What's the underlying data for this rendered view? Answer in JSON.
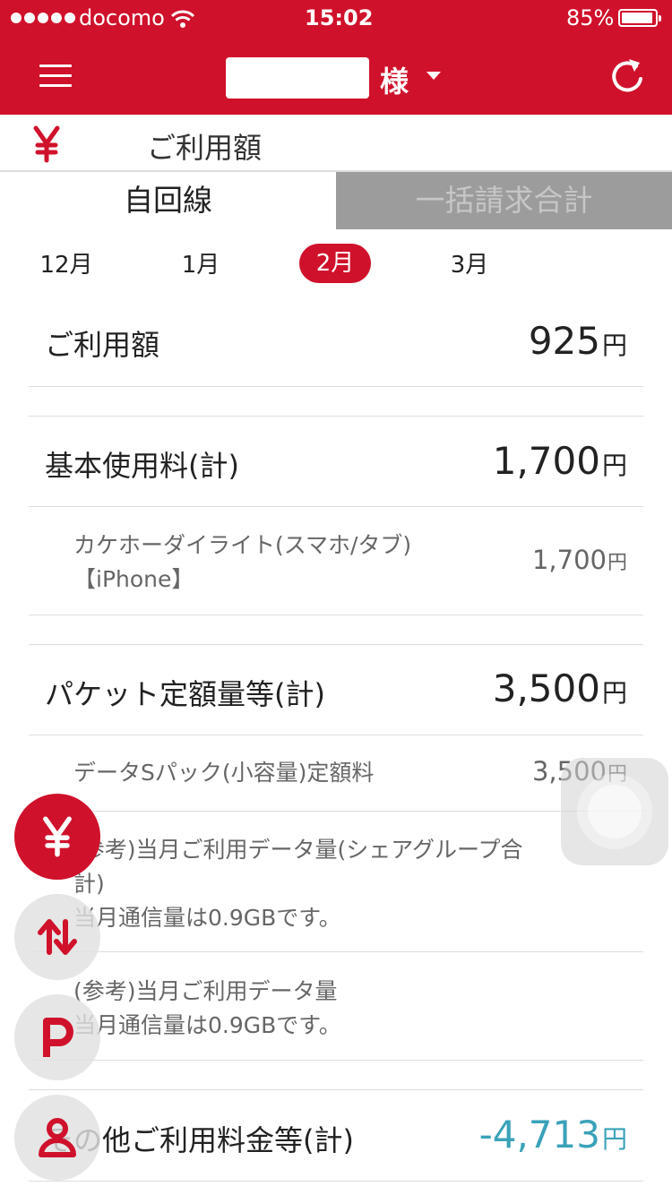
{
  "status_bar": {
    "carrier": "docomo",
    "time": "15:02",
    "battery": "85%"
  },
  "header": {
    "honorific": "様"
  },
  "section": {
    "title": "ご利用額"
  },
  "tabs": [
    {
      "label": "自回線"
    },
    {
      "label": "一括請求合計"
    }
  ],
  "months": [
    {
      "label": "12月"
    },
    {
      "label": "1月"
    },
    {
      "label": "2月",
      "selected": true
    },
    {
      "label": "3月"
    }
  ],
  "currency": "円",
  "summary": {
    "label": "ご利用額",
    "amount": "925"
  },
  "basic": {
    "label": "基本使用料(計)",
    "amount": "1,700",
    "item": {
      "line1": "カケホーダイライト(スマホ/タブ)",
      "line2": "【iPhone】",
      "amount": "1,700"
    }
  },
  "packet": {
    "label": "パケット定額量等(計)",
    "amount": "3,500",
    "item": {
      "label": "データSパック(小容量)定額料",
      "amount": "3,500"
    },
    "share_note": {
      "line1": "(参考)当月ご利用データ量(シェアグループ合",
      "line2": "計)",
      "line3": "当月通信量は0.9GBです。"
    },
    "own_note": {
      "line1": "(参考)当月ご利用データ量",
      "line2": "当月通信量は0.9GBです。"
    }
  },
  "other": {
    "label": "その他ご利用料金等(計)",
    "amount": "-4,713"
  },
  "colors": {
    "brand": "#d0112b",
    "negative": "#3aa2b8"
  }
}
